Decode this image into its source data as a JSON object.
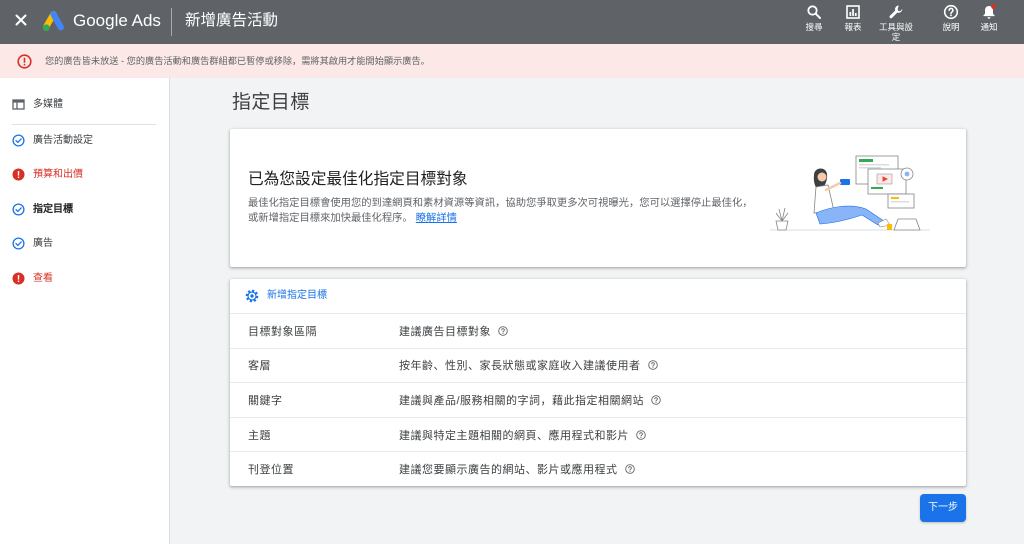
{
  "topbar": {
    "close_icon": "close-icon",
    "logo_icon": "google-ads-logo-icon",
    "product_name": "Google Ads",
    "page_title": "新增廣告活動",
    "actions": [
      {
        "icon": "search-icon",
        "label": "搜尋"
      },
      {
        "icon": "reports-icon",
        "label": "報表"
      },
      {
        "icon": "wrench-icon",
        "label": "工具與設定"
      },
      {
        "icon": "help-icon",
        "label": "說明"
      },
      {
        "icon": "bell-icon",
        "label": "通知"
      }
    ]
  },
  "alert": {
    "icon": "error-outline-icon",
    "text": "您的廣告皆未放送 - 您的廣告活動和廣告群組都已暫停或移除，需將其啟用才能開始顯示廣告。"
  },
  "sidebar": {
    "items": [
      {
        "icon": "table-icon",
        "label": "多媒體"
      },
      {
        "icon": "check-circle-icon",
        "label": "廣告活動設定"
      },
      {
        "icon": "error-icon",
        "label": "預算和出價"
      },
      {
        "icon": "check-circle-icon",
        "label": "指定目標",
        "current": true
      },
      {
        "icon": "check-circle-icon",
        "label": "廣告"
      },
      {
        "icon": "error-icon",
        "label": "查看"
      }
    ]
  },
  "main": {
    "title": "指定目標",
    "optimized_card": {
      "heading": "已為您設定最佳化指定目標對象",
      "description_lines": [
        "最佳化指定目標會使用您的到達網頁和素材資源等資訊，協助您爭取更多次可視曝光，您可以選擇停止最佳化，",
        "或新增指定目標來加快最佳化程序。"
      ],
      "link": "瞭解詳情",
      "illustration_icon": "person-with-screens-illustration"
    },
    "targeting": {
      "add_icon": "settings-icon",
      "add_label": "新增指定目標",
      "help_icon": "help-outline-icon",
      "rows": [
        {
          "label": "目標對象區隔",
          "suggestion": "建議廣告目標對象"
        },
        {
          "label": "客層",
          "suggestion": "按年齡、性別、家長狀態或家庭收入建議使用者"
        },
        {
          "label": "關鍵字",
          "suggestion": "建議與產品/服務相關的字詞，藉此指定相關網站"
        },
        {
          "label": "主題",
          "suggestion": "建議與特定主題相關的網頁、應用程式和影片"
        },
        {
          "label": "刊登位置",
          "suggestion": "建議您要顯示廣告的網站、影片或應用程式"
        }
      ]
    }
  },
  "footer": {
    "next_button": "下一步"
  },
  "colors": {
    "topbar_bg": "#5f6368",
    "alert_bg": "#fce8e6",
    "error": "#d93025",
    "accent": "#1a73e8",
    "page_bg": "#f1f3f4"
  }
}
